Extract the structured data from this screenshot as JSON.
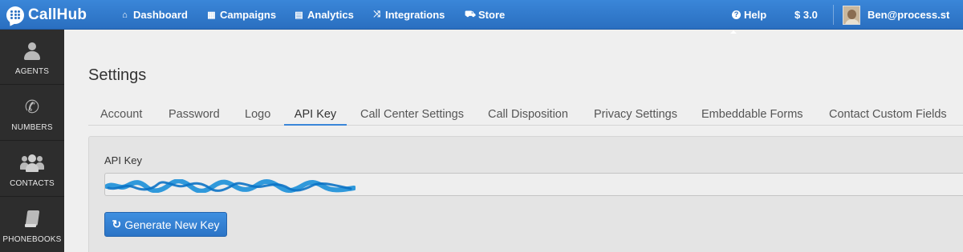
{
  "header": {
    "logo_text": "CallHub",
    "nav": [
      {
        "label": "Dashboard",
        "icon": "home-icon",
        "glyph": "⌂"
      },
      {
        "label": "Campaigns",
        "icon": "table-icon",
        "glyph": "▦"
      },
      {
        "label": "Analytics",
        "icon": "chart-icon",
        "glyph": "▤"
      },
      {
        "label": "Integrations",
        "icon": "shuffle-icon",
        "glyph": "⤨"
      },
      {
        "label": "Store",
        "icon": "cart-icon",
        "glyph": "⛟"
      }
    ],
    "help": {
      "label": "Help",
      "icon": "question-circle-icon",
      "glyph": "?"
    },
    "credits": "$ 3.0",
    "user_email": "Ben@process.st",
    "accent_color": "#2a6fc0"
  },
  "sidebar": {
    "items": [
      {
        "label": "AGENTS",
        "icon": "user-icon"
      },
      {
        "label": "NUMBERS",
        "icon": "phone-icon"
      },
      {
        "label": "CONTACTS",
        "icon": "users-icon"
      },
      {
        "label": "PHONEBOOKS",
        "icon": "book-icon"
      }
    ],
    "background_color": "#2d2d2d"
  },
  "main": {
    "title": "Settings",
    "tabs": [
      {
        "label": "Account",
        "active": false
      },
      {
        "label": "Password",
        "active": false
      },
      {
        "label": "Logo",
        "active": false
      },
      {
        "label": "API Key",
        "active": true
      },
      {
        "label": "Call Center Settings",
        "active": false
      },
      {
        "label": "Call Disposition",
        "active": false
      },
      {
        "label": "Privacy Settings",
        "active": false
      },
      {
        "label": "Embeddable Forms",
        "active": false
      },
      {
        "label": "Contact Custom Fields",
        "active": false
      }
    ],
    "api_key": {
      "label": "API Key",
      "value": "",
      "redaction_color": "#1b8fd8"
    },
    "generate_button": {
      "label": "Generate New Key",
      "icon": "refresh-icon"
    }
  }
}
